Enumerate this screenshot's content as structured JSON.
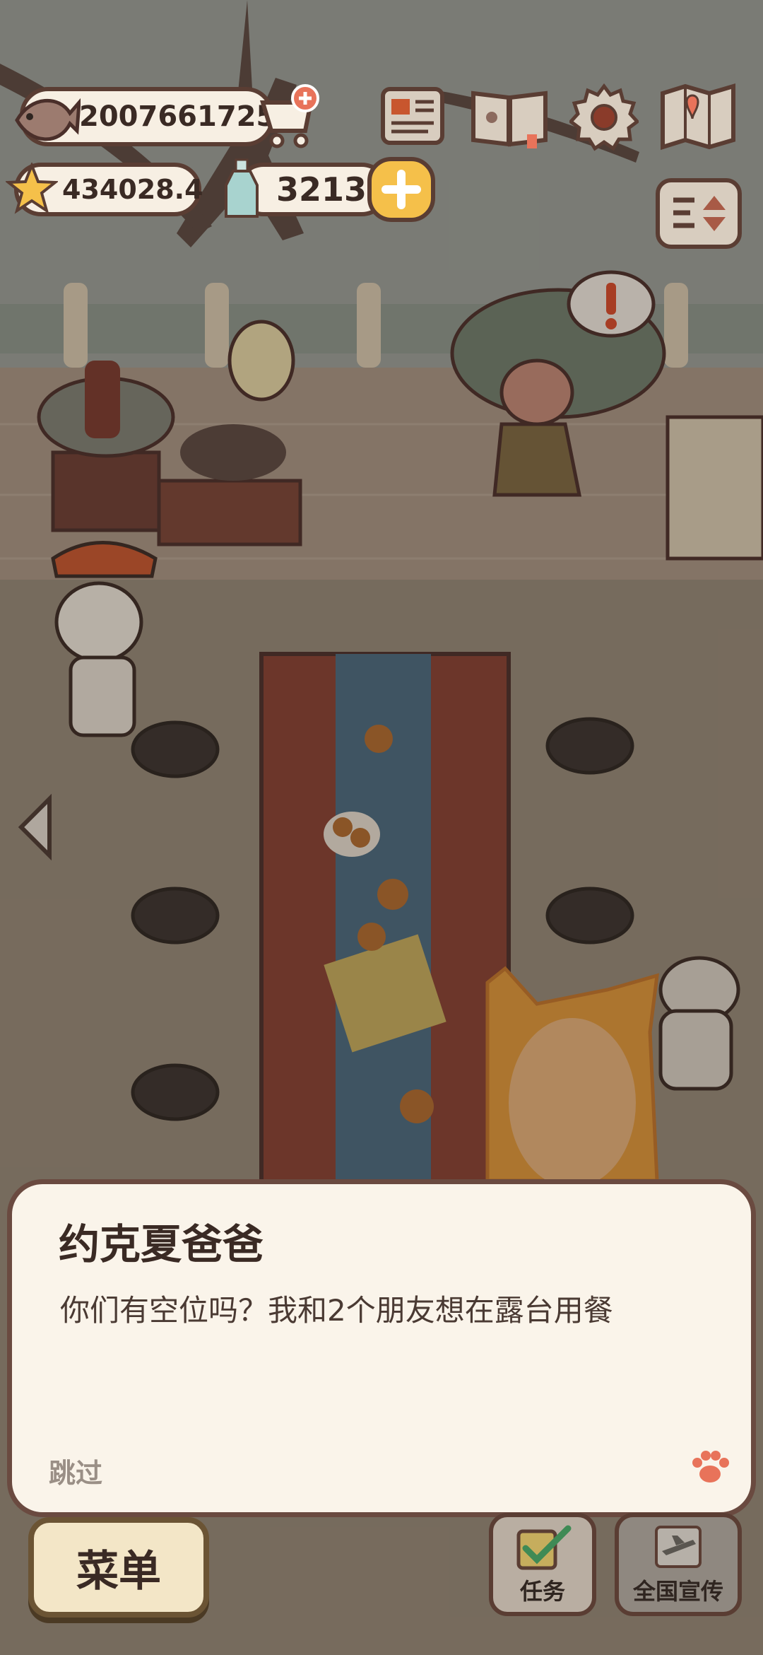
{
  "hud": {
    "fish_count": "2007661725",
    "star_count": "434028.4",
    "bottle_count": "3213"
  },
  "dialog": {
    "speaker": "约克夏爸爸",
    "message": "你们有空位吗？我和2个朋友想在露台用餐",
    "skip_label": "跳过"
  },
  "bottom_bar": {
    "menu_label": "菜单",
    "tasks_label": "任务",
    "promo_label": "全国宣传"
  },
  "colors": {
    "outline": "#5a3d33",
    "panel": "#faf4ea",
    "accent_yellow": "#f5c04a",
    "accent_orange": "#e8735a"
  }
}
